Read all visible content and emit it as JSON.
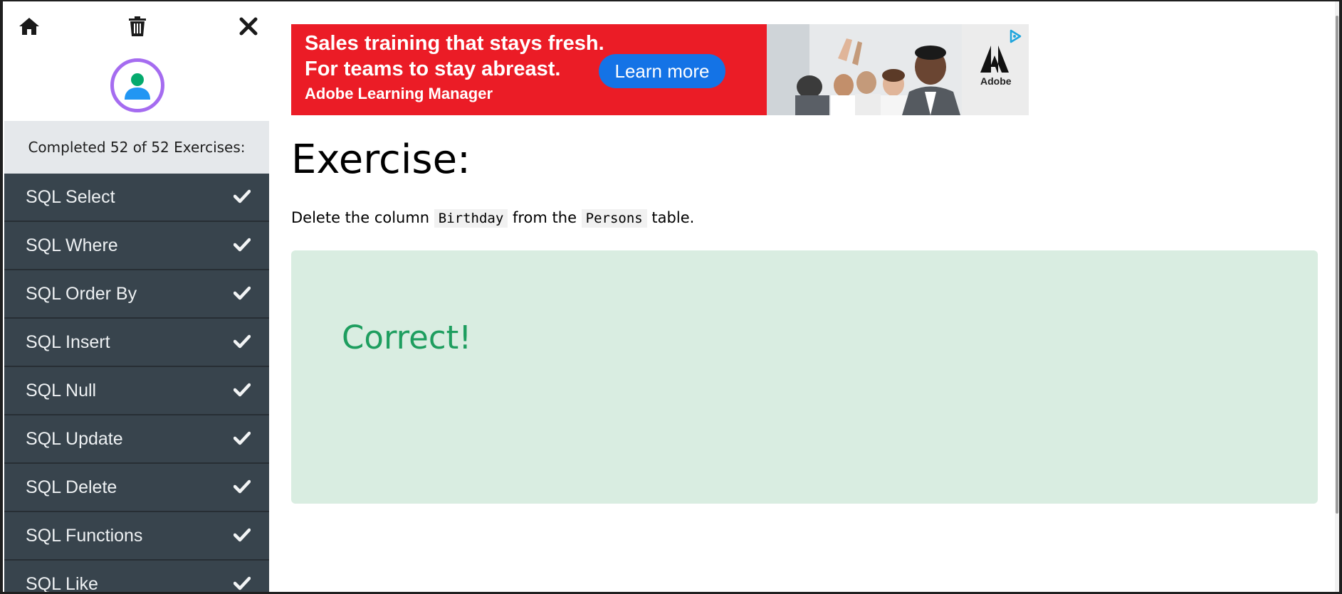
{
  "sidebar": {
    "home_icon": "home-icon",
    "trash_icon": "trash-icon",
    "close_icon": "close-icon",
    "avatar_icon": "user-icon",
    "progress_text": "Completed 52 of 52 Exercises:",
    "items": [
      {
        "label": "SQL Select",
        "completed": true
      },
      {
        "label": "SQL Where",
        "completed": true
      },
      {
        "label": "SQL Order By",
        "completed": true
      },
      {
        "label": "SQL Insert",
        "completed": true
      },
      {
        "label": "SQL Null",
        "completed": true
      },
      {
        "label": "SQL Update",
        "completed": true
      },
      {
        "label": "SQL Delete",
        "completed": true
      },
      {
        "label": "SQL Functions",
        "completed": true
      },
      {
        "label": "SQL Like",
        "completed": true
      }
    ]
  },
  "ad": {
    "line1": "Sales training that stays fresh.",
    "line2": "For teams to stay abreast.",
    "line3": "Adobe Learning Manager",
    "cta": "Learn more",
    "logo_text": "Adobe",
    "colors": {
      "background": "#eb1c26",
      "cta": "#1473e6"
    }
  },
  "exercise": {
    "title": "Exercise:",
    "instruction_pre": "Delete the column ",
    "column_name": "Birthday",
    "instruction_mid": " from the ",
    "table_name": "Persons",
    "instruction_post": " table.",
    "result": "Correct!",
    "colors": {
      "result_bg": "#d9ede1",
      "result_text": "#1e9e5f"
    }
  }
}
